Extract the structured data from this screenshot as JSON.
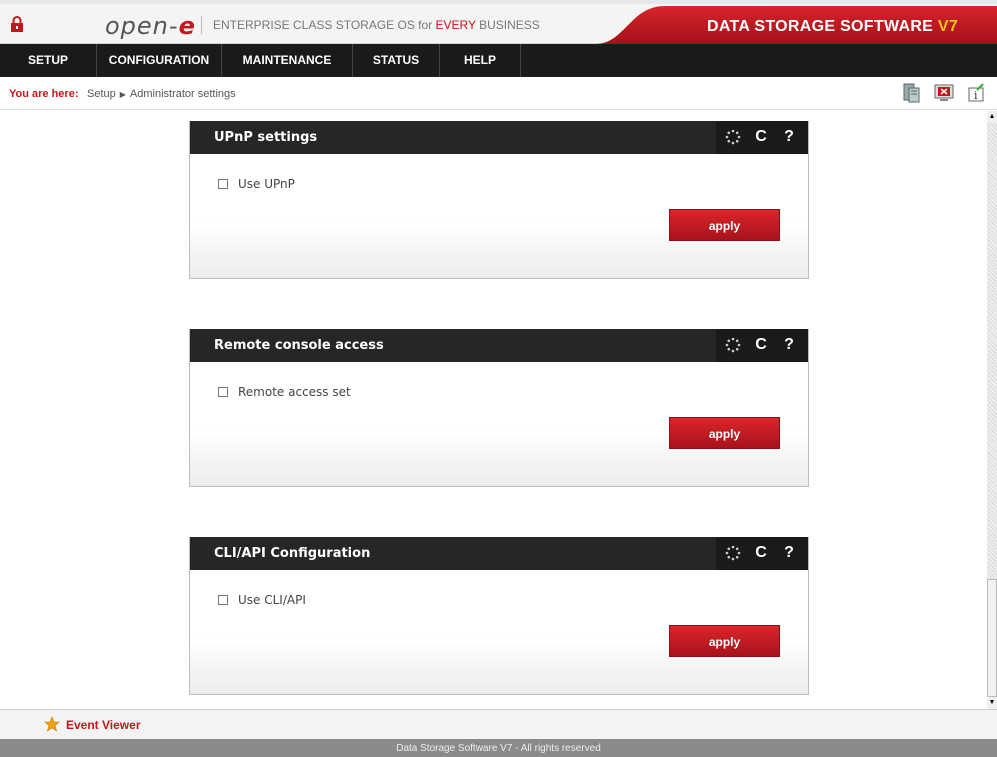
{
  "header": {
    "logo_text": "open-",
    "logo_e": "e",
    "tagline_pre": "ENTERPRISE CLASS STORAGE OS for ",
    "tagline_red": "EVERY",
    "tagline_post": " BUSINESS",
    "brand": "DATA STORAGE SOFTWARE ",
    "brand_version": "V7",
    "accent_color": "#c4161c"
  },
  "nav": {
    "items": [
      {
        "label": "SETUP"
      },
      {
        "label": "CONFIGURATION"
      },
      {
        "label": "MAINTENANCE"
      },
      {
        "label": "STATUS"
      },
      {
        "label": "HELP"
      }
    ]
  },
  "breadcrumb": {
    "prefix": "You are here:",
    "items": [
      "Setup",
      "Administrator settings"
    ]
  },
  "panels": [
    {
      "title": "UPnP settings",
      "checkbox_label": "Use UPnP",
      "checked": false,
      "apply_label": "apply"
    },
    {
      "title": "Remote console access",
      "checkbox_label": "Remote access set",
      "checked": false,
      "apply_label": "apply"
    },
    {
      "title": "CLI/API Configuration",
      "checkbox_label": "Use CLI/API",
      "checked": false,
      "apply_label": "apply"
    }
  ],
  "panel_tools": {
    "refresh_glyph": "C",
    "help_glyph": "?"
  },
  "footer": {
    "event_viewer": "Event Viewer",
    "copyright": "Data Storage Software V7 - All rights reserved"
  }
}
